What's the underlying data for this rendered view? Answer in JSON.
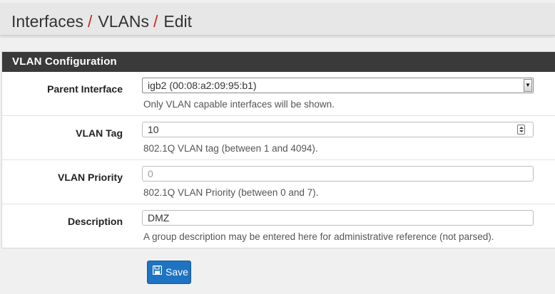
{
  "breadcrumb": {
    "items": [
      "Interfaces",
      "VLANs",
      "Edit"
    ],
    "separator": "/"
  },
  "panel": {
    "title": "VLAN Configuration"
  },
  "form": {
    "parent_interface": {
      "label": "Parent Interface",
      "value": "igb2 (00:08:a2:09:95:b1)",
      "help": "Only VLAN capable interfaces will be shown."
    },
    "vlan_tag": {
      "label": "VLAN Tag",
      "value": "10",
      "help": "802.1Q VLAN tag (between 1 and 4094)."
    },
    "vlan_priority": {
      "label": "VLAN Priority",
      "value": "",
      "placeholder": "0",
      "help": "802.1Q VLAN Priority (between 0 and 7)."
    },
    "description": {
      "label": "Description",
      "value": "DMZ",
      "help": "A group description may be entered here for administrative reference (not parsed)."
    }
  },
  "actions": {
    "save_label": "Save",
    "save_icon": "floppy-disk-icon"
  },
  "colors": {
    "header_bg": "#e7e7e7",
    "separator": "#c62828",
    "panel_heading_bg": "#3a3a3a",
    "primary_button": "#1e73c2"
  }
}
